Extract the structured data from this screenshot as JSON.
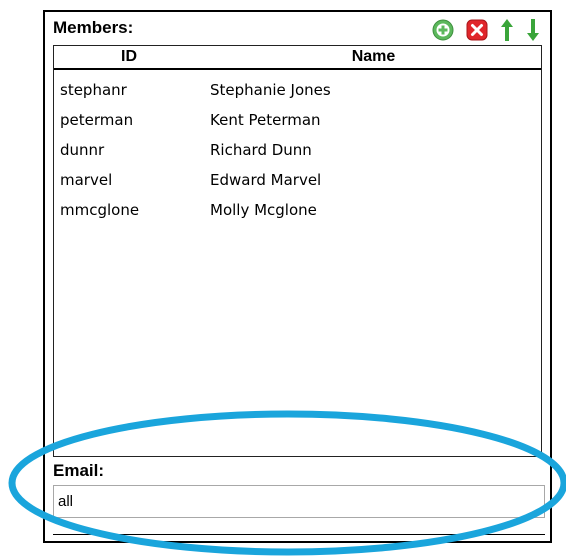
{
  "members": {
    "title": "Members:",
    "columns": {
      "id": "ID",
      "name": "Name"
    },
    "rows": [
      {
        "id": "stephanr",
        "name": "Stephanie Jones"
      },
      {
        "id": "peterman",
        "name": "Kent Peterman"
      },
      {
        "id": "dunnr",
        "name": "Richard Dunn"
      },
      {
        "id": "marvel",
        "name": "Edward Marvel"
      },
      {
        "id": "mmcglone",
        "name": "Molly Mcglone"
      }
    ],
    "toolbar": {
      "add_icon": "add-icon",
      "remove_icon": "remove-icon",
      "move_up_icon": "arrow-up-icon",
      "move_down_icon": "arrow-down-icon"
    }
  },
  "email": {
    "label": "Email:",
    "value": "all"
  },
  "colors": {
    "add_green": "#5cb85c",
    "remove_red": "#e0262b",
    "arrow_green": "#3aa53a",
    "highlight_blue": "#1aa5dc"
  }
}
